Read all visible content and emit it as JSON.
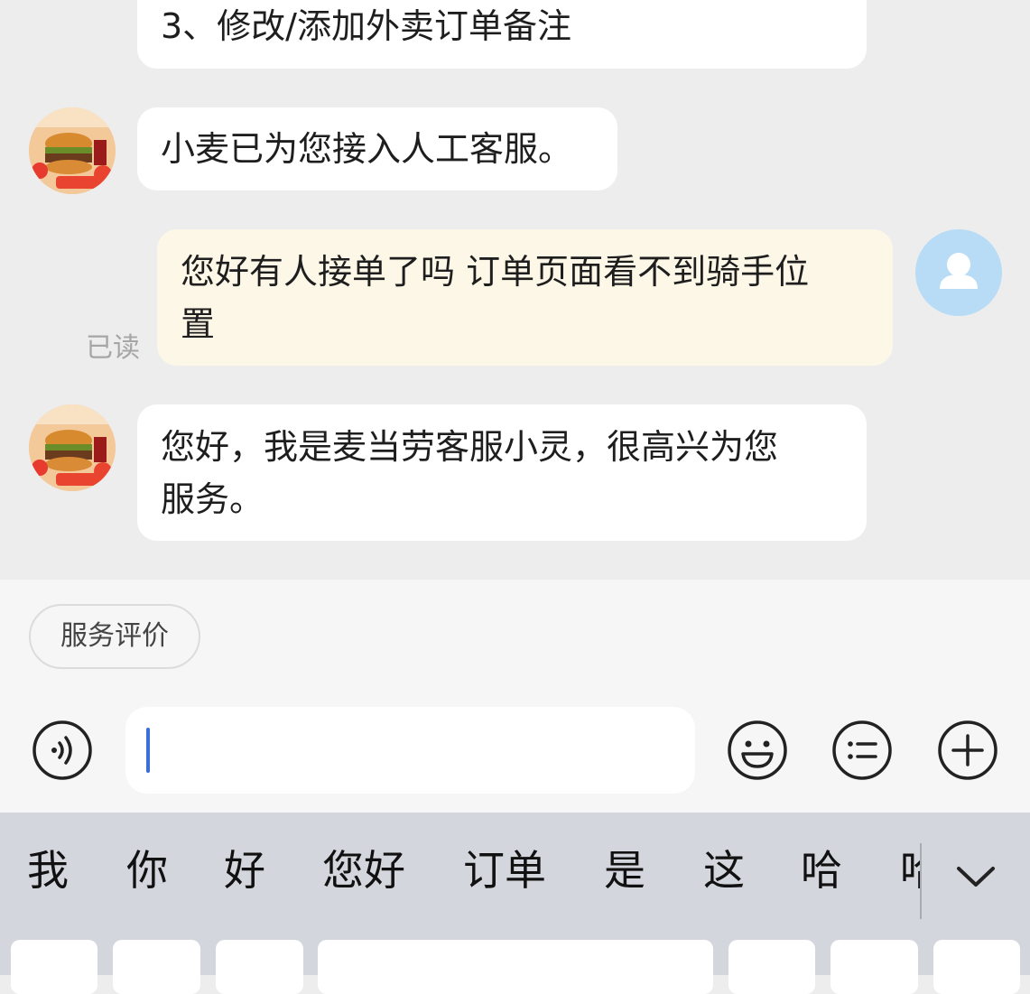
{
  "messages": [
    {
      "id": "m0",
      "side": "bot",
      "lines": [
        "3、修改/添加外卖订单备注"
      ]
    },
    {
      "id": "m1",
      "side": "bot",
      "lines": [
        "小麦已为您接入人工客服。"
      ]
    },
    {
      "id": "m2",
      "side": "user",
      "lines": [
        "您好有人接单了吗 订单页面看不到骑手位",
        "置"
      ],
      "status": "已读"
    },
    {
      "id": "m3",
      "side": "bot",
      "lines": [
        "您好，我是麦当劳客服小灵，很高兴为您",
        "服务。"
      ]
    }
  ],
  "quick_reply": {
    "label": "服务评价"
  },
  "input": {
    "value": ""
  },
  "candidates": [
    "我",
    "你",
    "好",
    "您好",
    "订单",
    "是",
    "这",
    "哈",
    "哈"
  ],
  "colors": {
    "chat_bg": "#ededed",
    "bot_bubble": "#ffffff",
    "user_bubble": "#fdf7e7",
    "user_avatar": "#b9dcf6",
    "caret": "#3b6fd8",
    "keyboard_bg": "#d3d6dc"
  },
  "icons": {
    "voice": "voice-icon",
    "emoji": "emoji-icon",
    "menu": "menu-list-icon",
    "plus": "plus-icon",
    "collapse": "chevron-down-icon",
    "user": "user-icon"
  }
}
